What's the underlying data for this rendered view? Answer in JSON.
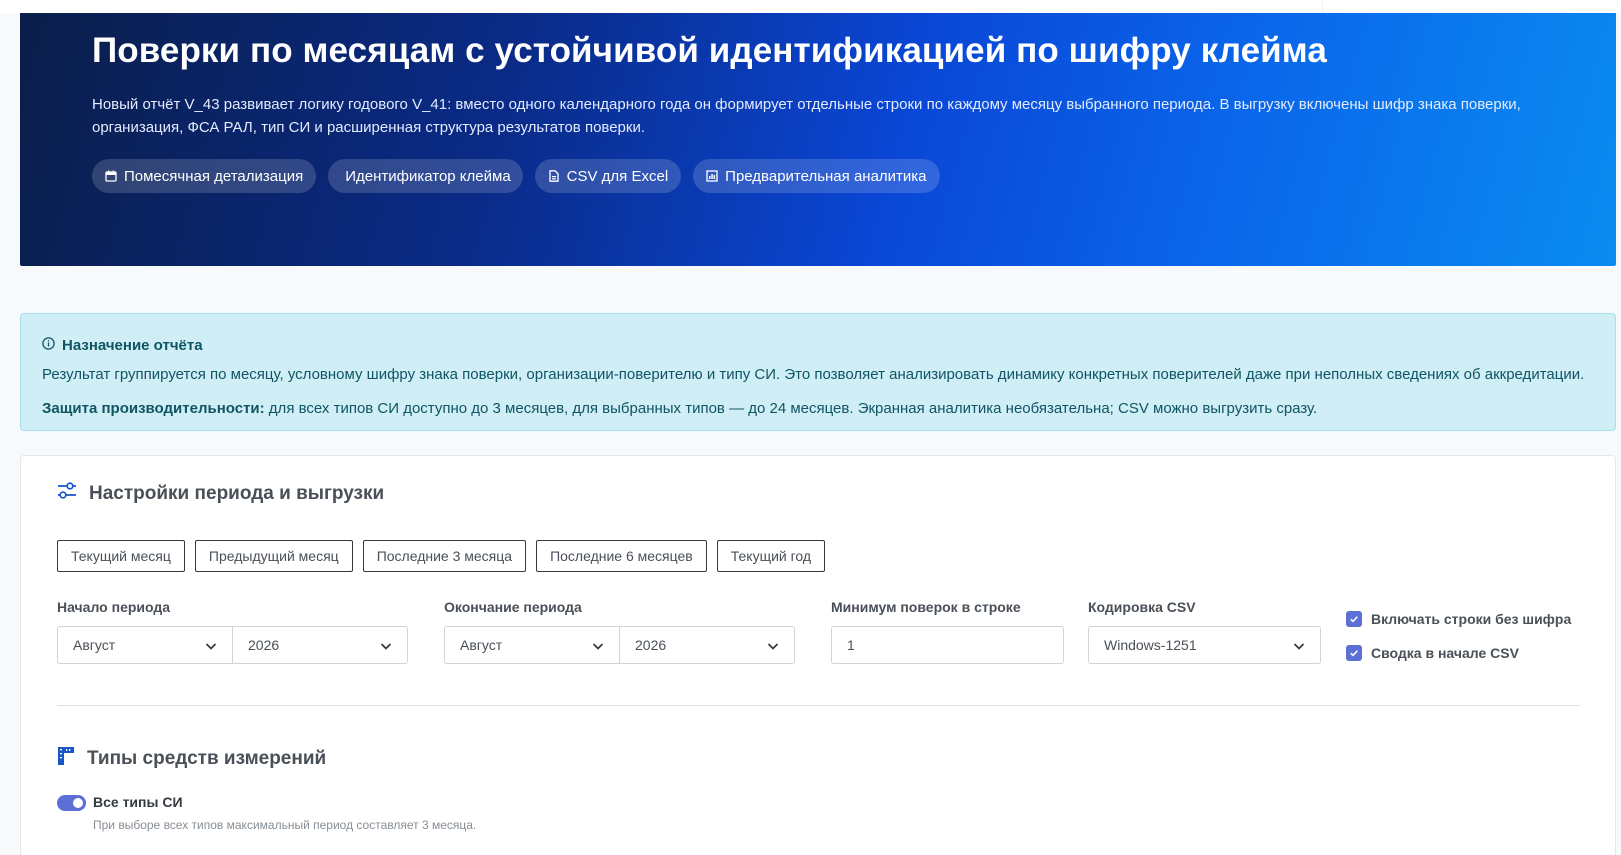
{
  "hero": {
    "title": "Поверки по месяцам с устойчивой идентификацией по шифру клейма",
    "description": "Новый отчёт V_43 развивает логику годового V_41: вместо одного календарного года он формирует отдельные строки по каждому месяцу выбранного периода. В выгрузку включены шифр знака поверки, организация, ФСА РАЛ, тип СИ и расширенная структура результатов поверки.",
    "chips": [
      {
        "label": "Помесячная детализация",
        "icon": "calendar-icon"
      },
      {
        "label": "Идентификатор клейма",
        "icon": ""
      },
      {
        "label": "CSV для Excel",
        "icon": "file-icon"
      },
      {
        "label": "Предварительная аналитика",
        "icon": "chart-icon"
      }
    ]
  },
  "info": {
    "title": "Назначение отчёта",
    "text1": "Результат группируется по месяцу, условному шифру знака поверки, организации-поверителю и типу СИ. Это позволяет анализировать динамику конкретных поверителей даже при неполных сведениях об аккредитации.",
    "text2_bold": "Защита производительности:",
    "text2": " для всех типов СИ доступно до 3 месяцев, для выбранных типов — до 24 месяцев. Экранная аналитика необязательна; CSV можно выгрузить сразу."
  },
  "settings": {
    "title": "Настройки периода и выгрузки",
    "presets": [
      "Текущий месяц",
      "Предыдущий месяц",
      "Последние 3 месяца",
      "Последние 6 месяцев",
      "Текущий год"
    ],
    "start_label": "Начало периода",
    "start_month": "Август",
    "start_year": "2026",
    "end_label": "Окончание периода",
    "end_month": "Август",
    "end_year": "2026",
    "min_label": "Минимум поверок в строке",
    "min_value": "1",
    "encoding_label": "Кодировка CSV",
    "encoding_value": "Windows-1251",
    "include_no_cipher": "Включать строки без шифра",
    "summary_first": "Сводка в начале CSV"
  },
  "types": {
    "title": "Типы средств измерений",
    "all_label": "Все типы СИ",
    "all_hint": "При выборе всех типов максимальный период составляет 3 месяца."
  },
  "colors": {
    "accent": "#5b6fd6",
    "info_bg": "#cfeef5",
    "info_text": "#0f5563",
    "hero_start": "#0a1e4a",
    "hero_end": "#0a8cf0"
  }
}
